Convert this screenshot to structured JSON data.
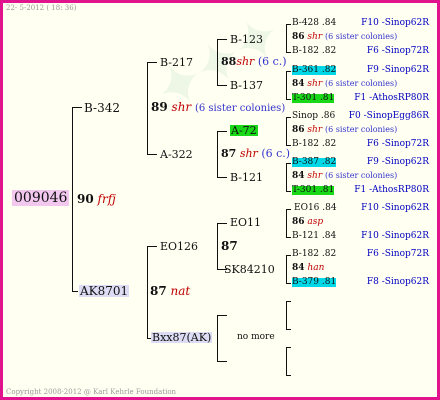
{
  "header": {
    "text": "22- 5-2012 ( 18: 36)"
  },
  "footer": {
    "text": "Copyright 2008-2012 @ Karl Kehrle Foundation"
  },
  "root": {
    "id": "009046"
  },
  "gen1": {
    "num": "90",
    "color": "frfj",
    "sire": "B-342",
    "dam": "AK8701"
  },
  "gen2": {
    "s_num": "89",
    "s_color": "shr",
    "s_note": "(6 sister colonies)",
    "d_num": "87",
    "d_color": "nat",
    "ss": "B-217",
    "sd": "A-322",
    "ds": "EO126",
    "dd": "Bxx87(AK)"
  },
  "gen3": {
    "a_num": "88",
    "a_color": "shr",
    "a_note": "(6 c.)",
    "b_num": "87",
    "b_color": "shr",
    "b_note": "(6 c.)",
    "c_num": "87",
    "d_text": "no more",
    "a1": "B-123",
    "a2": "B-137",
    "b1": "A-72",
    "b2": "B-121",
    "c1": "EO11",
    "c2": "SK84210"
  },
  "gen4": [
    {
      "top": "B-428 .84",
      "top_r": "F10 -Sinop62R",
      "num": "86",
      "color": "shr",
      "note": "(6 sister colonies)",
      "bot": "B-182 .82",
      "bot_r": "F6 -Sinop72R"
    },
    {
      "top": "B-361 .82",
      "top_r": "F9 -Sinop62R",
      "num": "84",
      "color": "shr",
      "note": "(6 sister colonies)",
      "bot": "T-301 .81",
      "bot_r": "F1 -AthosRP80R"
    },
    {
      "top": "Sinop .86",
      "top_r": "F0 -SinopEgg86R",
      "num": "86",
      "color": "shr",
      "note": "(6 sister colonies)",
      "bot": "B-182 .82",
      "bot_r": "F6 -Sinop72R"
    },
    {
      "top": "B-387 .82",
      "top_r": "F9 -Sinop62R",
      "num": "84",
      "color": "shr",
      "note": "(6 sister colonies)",
      "bot": "T-301 .81",
      "bot_r": "F1 -AthosRP80R"
    },
    {
      "top": "EO16 .84",
      "top_r": "F10 -Sinop62R",
      "num": "86",
      "color": "asp",
      "note": "",
      "bot": "B-121 .84",
      "bot_r": "F10 -Sinop62R"
    },
    {
      "top": "B-182 .82",
      "top_r": "F6 -Sinop72R",
      "num": "84",
      "color": "han",
      "note": "",
      "bot": "B-379 .81",
      "bot_r": "F8 -Sinop62R"
    }
  ]
}
